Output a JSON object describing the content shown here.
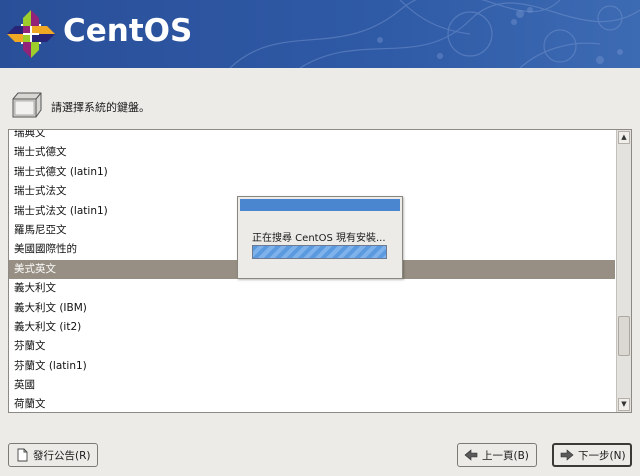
{
  "header": {
    "brand": "CentOS"
  },
  "prompt": {
    "text": "請選擇系統的鍵盤。"
  },
  "keyboard_list": {
    "items": [
      "瑞典文",
      "瑞士式德文",
      "瑞士式德文 (latin1)",
      "瑞士式法文",
      "瑞士式法文 (latin1)",
      "羅馬尼亞文",
      "美國國際性的",
      "美式英文",
      "義大利文",
      "義大利文 (IBM)",
      "義大利文 (it2)",
      "芬蘭文",
      "芬蘭文 (latin1)",
      "英國",
      "荷蘭文"
    ],
    "selected": "美式英文"
  },
  "dialog": {
    "message": "正在搜尋 CentOS 現有安裝...",
    "progress": 1.0
  },
  "buttons": {
    "release_notes": "發行公告(R)",
    "back": "上一頁(B)",
    "next": "下一步(N)"
  },
  "colors": {
    "banner": "#2a4f99",
    "selection": "#978f83",
    "progress": "#5c9ae0"
  }
}
